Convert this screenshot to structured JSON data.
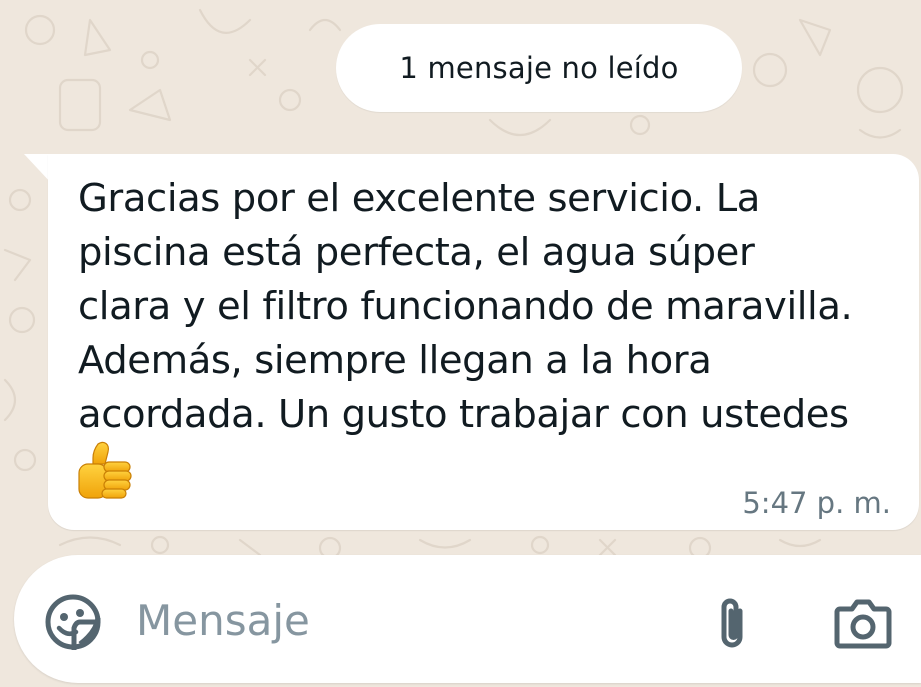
{
  "chat": {
    "unread_label": "1 mensaje no leído",
    "message": {
      "text": "Gracias por el excelente servicio. La\npiscina está perfecta, el agua súper\nclara y el filtro funcionando de maravilla.\nAdemás, siempre llegan a la hora\nacordada. Un gusto trabajar con ustedes",
      "emoji": "thumbs-up",
      "time": "5:47 p. m."
    }
  },
  "composer": {
    "placeholder": "Mensaje",
    "emoji_icon": "emoji-sticker-icon",
    "attach_icon": "paperclip-icon",
    "camera_icon": "camera-icon"
  },
  "colors": {
    "background": "#efe7dd",
    "bubble": "#ffffff",
    "text": "#111b21",
    "meta": "#667781",
    "icon": "#54656f"
  }
}
